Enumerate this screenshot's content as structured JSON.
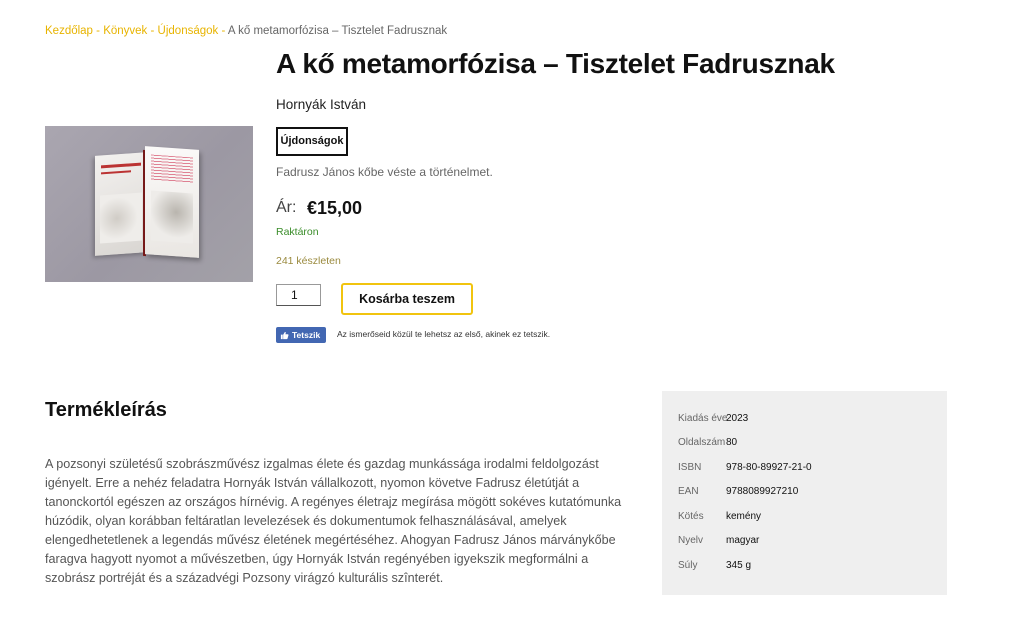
{
  "breadcrumb": {
    "home": "Kezdőlap",
    "books": "Könyvek",
    "new": "Újdonságok",
    "current": "A kő metamorfózisa – Tisztelet Fadrusznak",
    "separator": " - "
  },
  "product": {
    "title": "A kő metamorfózisa – Tisztelet Fadrusznak",
    "author": "Hornyák István",
    "category": "Újdonságok",
    "short_description": "Fadrusz János kőbe véste a történelmet.",
    "price_label": "Ár:",
    "price": "€15,00",
    "stock_status": "Raktáron",
    "stock_count": "241 készleten",
    "quantity": "1",
    "add_to_cart": "Kosárba teszem"
  },
  "social": {
    "like_label": "Tetszik",
    "like_text": "Az ismerőseid közül te lehetsz az első, akinek ez tetszik."
  },
  "description": {
    "heading": "Termékleírás",
    "text": "A pozsonyi születésű szobrászművész izgalmas élete és gazdag munkássága irodalmi feldolgozást igényelt. Erre a nehéz feladatra Hornyák István vállalkozott, nyomon követve Fadrusz életútját a tanonckortól egészen az országos hírnévig. A regényes életrajz megírása mögött sokéves kutatómunka húzódik, olyan korábban feltáratlan levelezések és dokumentumok felhasználásával, amelyek elengedhetetlenek a legendás művész életének megértéséhez. Ahogyan Fadrusz János márványkőbe faragva hagyott nyomot a művészetben, úgy Hornyák István regényében igyekszik megformálni a szobrász portréját és a századvégi Pozsony virágzó kulturális szînterét."
  },
  "specs": [
    {
      "label": "Kiadás éve",
      "value": "2023"
    },
    {
      "label": "Oldalszám",
      "value": "80"
    },
    {
      "label": "ISBN",
      "value": "978-80-89927-21-0"
    },
    {
      "label": "EAN",
      "value": "9788089927210"
    },
    {
      "label": "Kötés",
      "value": "kemény"
    },
    {
      "label": "Nyelv",
      "value": "magyar"
    },
    {
      "label": "Súly",
      "value": "345 g"
    }
  ],
  "colors": {
    "accent": "#e8b400",
    "button_border": "#f1c40f",
    "stock_green": "#3a8d2a",
    "facebook": "#4267b2",
    "spec_bg": "#efefef"
  }
}
